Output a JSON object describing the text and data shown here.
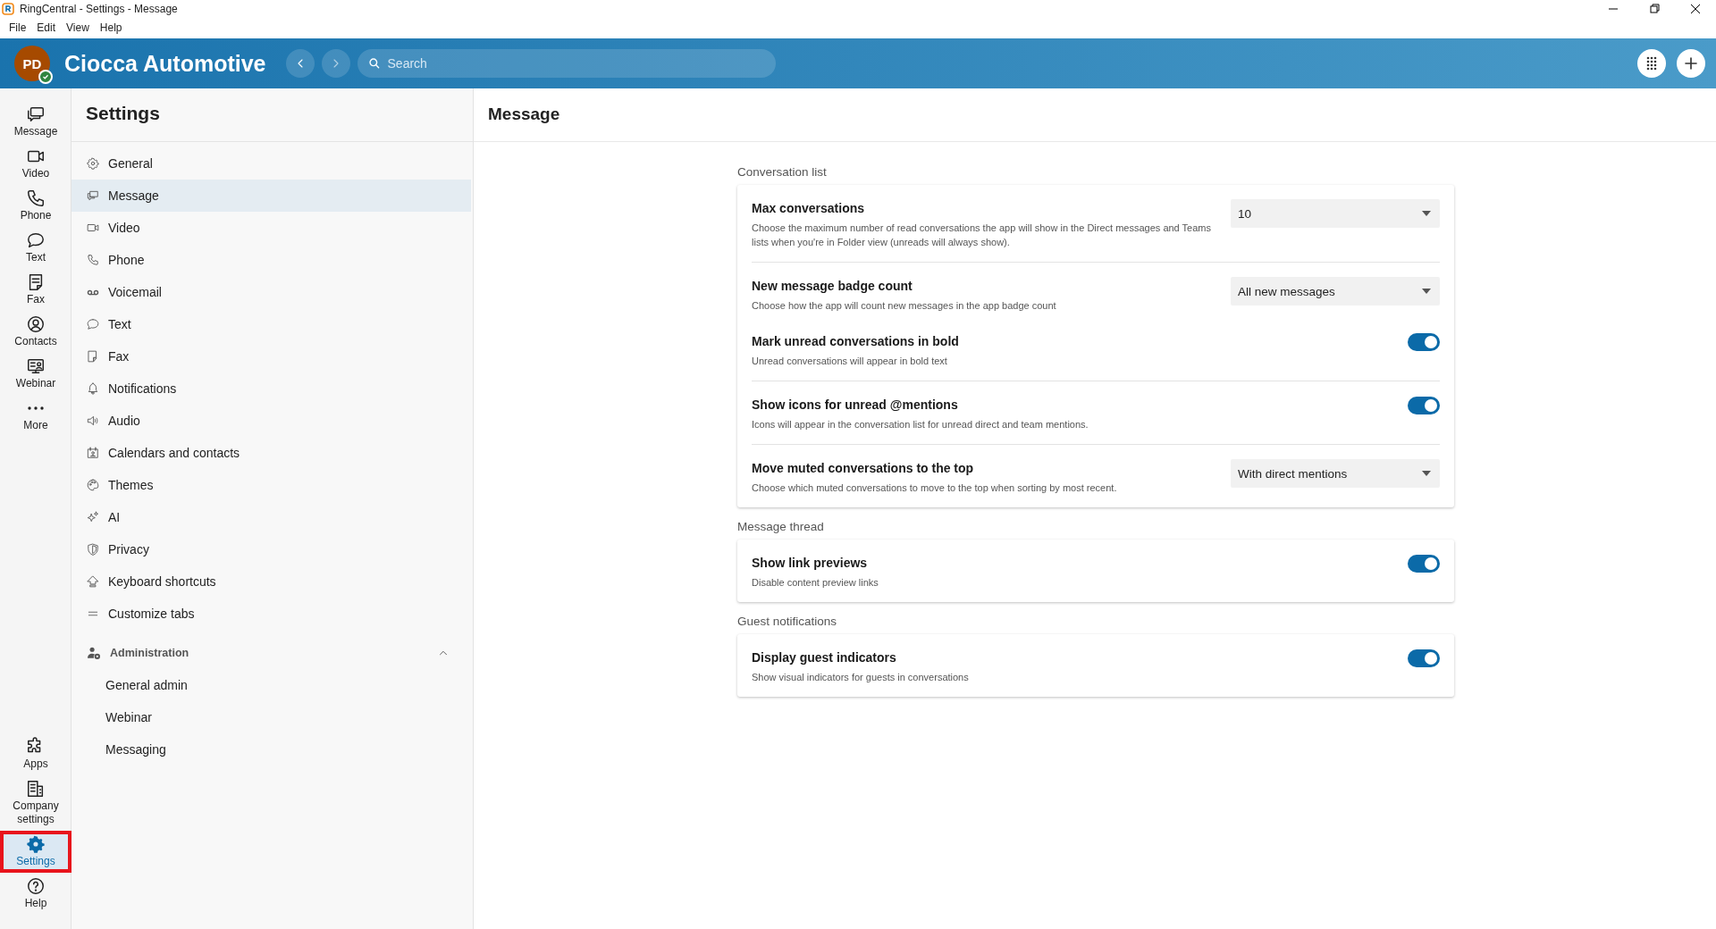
{
  "window": {
    "title": "RingCentral - Settings - Message",
    "menu": [
      "File",
      "Edit",
      "View",
      "Help"
    ]
  },
  "header": {
    "avatar_initials": "PD",
    "company": "Ciocca Automotive",
    "search": {
      "placeholder": "Search"
    }
  },
  "rail": {
    "top": [
      {
        "label": "Message",
        "selected": false
      },
      {
        "label": "Video",
        "selected": false
      },
      {
        "label": "Phone",
        "selected": false
      },
      {
        "label": "Text",
        "selected": false
      },
      {
        "label": "Fax",
        "selected": false
      },
      {
        "label": "Contacts",
        "selected": false
      },
      {
        "label": "Webinar",
        "selected": false
      },
      {
        "label": "More",
        "selected": false
      }
    ],
    "bottom": [
      {
        "label": "Apps",
        "selected": false,
        "highlighted": false
      },
      {
        "label": "Company settings",
        "selected": false,
        "highlighted": false
      },
      {
        "label": "Settings",
        "selected": true,
        "highlighted": true
      },
      {
        "label": "Help",
        "selected": false,
        "highlighted": false
      }
    ]
  },
  "settings_nav": {
    "title": "Settings",
    "items": [
      {
        "label": "General",
        "selected": false
      },
      {
        "label": "Message",
        "selected": true
      },
      {
        "label": "Video",
        "selected": false
      },
      {
        "label": "Phone",
        "selected": false
      },
      {
        "label": "Voicemail",
        "selected": false
      },
      {
        "label": "Text",
        "selected": false
      },
      {
        "label": "Fax",
        "selected": false
      },
      {
        "label": "Notifications",
        "selected": false
      },
      {
        "label": "Audio",
        "selected": false
      },
      {
        "label": "Calendars and contacts",
        "selected": false
      },
      {
        "label": "Themes",
        "selected": false
      },
      {
        "label": "AI",
        "selected": false
      },
      {
        "label": "Privacy",
        "selected": false
      },
      {
        "label": "Keyboard shortcuts",
        "selected": false
      },
      {
        "label": "Customize tabs",
        "selected": false
      }
    ],
    "admin": {
      "label": "Administration",
      "expanded": true,
      "children": [
        {
          "label": "General admin",
          "selected": false
        },
        {
          "label": "Webinar",
          "selected": false
        },
        {
          "label": "Messaging",
          "selected": false
        }
      ]
    }
  },
  "page": {
    "title": "Message",
    "sections": [
      {
        "title": "Conversation list",
        "rows": [
          {
            "kind": "select",
            "title": "Max conversations",
            "description": "Choose the maximum number of read conversations the app will show in the Direct messages and Teams lists when you're in Folder view (unreads will always show).",
            "value": "10",
            "divider": true
          },
          {
            "kind": "select",
            "title": "New message badge count",
            "description": "Choose how the app will count new messages in the app badge count",
            "value": "All new messages",
            "divider": false
          },
          {
            "kind": "toggle",
            "title": "Mark unread conversations in bold",
            "description": "Unread conversations will appear in bold text",
            "on": true,
            "divider": true
          },
          {
            "kind": "toggle",
            "title": "Show icons for unread @mentions",
            "description": "Icons will appear in the conversation list for unread direct and team mentions.",
            "on": true,
            "divider": true
          },
          {
            "kind": "select",
            "title": "Move muted conversations to the top",
            "description": "Choose which muted conversations to move to the top when sorting by most recent.",
            "value": "With direct mentions",
            "divider": false
          }
        ]
      },
      {
        "title": "Message thread",
        "rows": [
          {
            "kind": "toggle",
            "title": "Show link previews",
            "description": "Disable content preview links",
            "on": true,
            "divider": false
          }
        ]
      },
      {
        "title": "Guest notifications",
        "rows": [
          {
            "kind": "toggle",
            "title": "Display guest indicators",
            "description": "Show visual indicators for guests in conversations",
            "on": true,
            "divider": false
          }
        ]
      }
    ]
  }
}
